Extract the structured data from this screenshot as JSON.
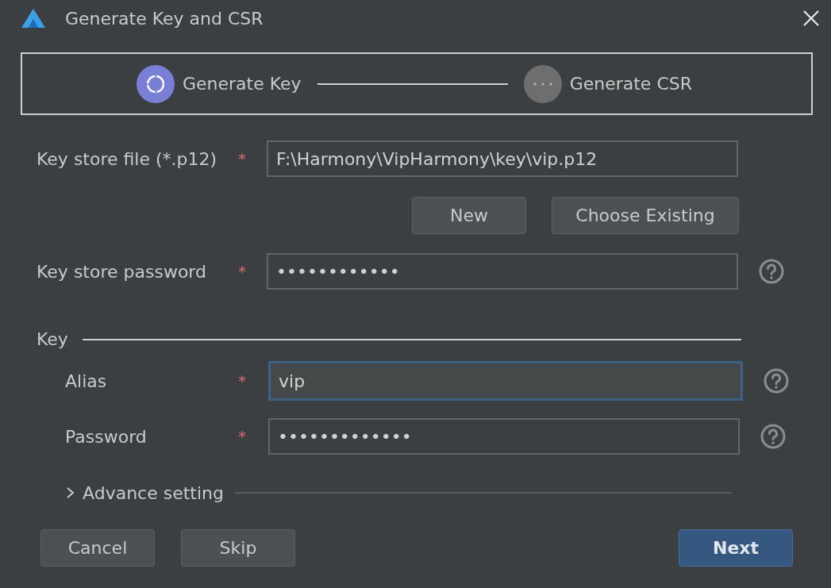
{
  "window": {
    "title": "Generate Key and CSR"
  },
  "steps": [
    {
      "label": "Generate Key",
      "selected": true
    },
    {
      "label": "Generate CSR",
      "selected": false
    }
  ],
  "keystore": {
    "file": {
      "label": "Key store file (*.p12)",
      "required": "*",
      "value": "F:\\Harmony\\VipHarmony\\key\\vip.p12"
    },
    "buttons": [
      "New",
      "Choose Existing"
    ],
    "password": {
      "label": "Key store password",
      "required": "*",
      "value": "••••••••••••"
    }
  },
  "key_section": {
    "title": "Key",
    "fields": [
      {
        "label": "Alias",
        "required": "*",
        "value": "vip",
        "focused": true
      },
      {
        "label": "Password",
        "required": "*",
        "value": "•••••••••••••",
        "focused": false
      }
    ],
    "advance": {
      "label": "Advance setting",
      "expanded": false
    }
  },
  "footer": {
    "buttons": [
      {
        "label": "Cancel",
        "primary": false
      },
      {
        "label": "Skip",
        "primary": false
      },
      {
        "label": "Next",
        "primary": true
      }
    ]
  }
}
